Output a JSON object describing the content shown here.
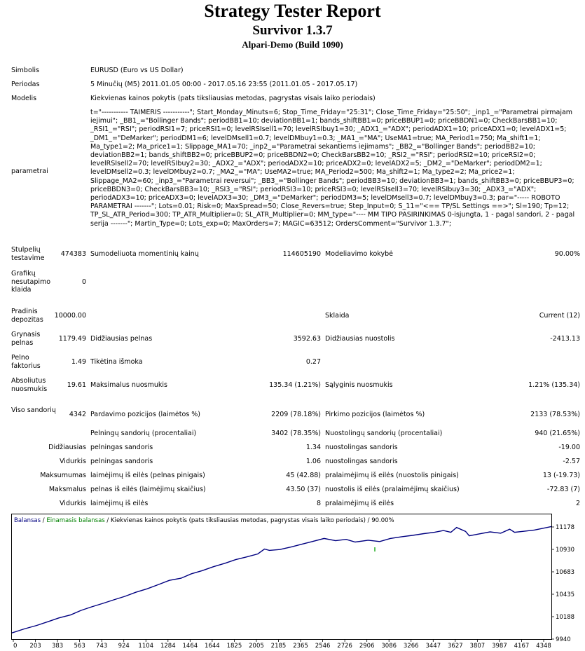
{
  "header": {
    "title": "Strategy Tester Report",
    "subtitle": "Survivor 1.3.7",
    "server": "Alpari-Demo (Build 1090)"
  },
  "info": {
    "symbol_label": "Simbolis",
    "symbol_value": "EURUSD (Euro vs US Dollar)",
    "period_label": "Periodas",
    "period_value": "5 Minučių (M5) 2011.01.05 00:00 - 2017.05.16 23:55 (2011.01.05 - 2017.05.17)",
    "model_label": "Modelis",
    "model_value": "Kiekvienas kainos pokytis (pats tiksliausias metodas, pagrystas visais laiko periodais)",
    "params_label": "parametrai",
    "params_value": "t=\"----------- TAIMERIS -----------\"; Start_Monday_Minuts=6; Stop_Time_Friday=\"25:31\"; Close_Time_Friday=\"25:50\"; _inp1_=\"Parametrai pirmajam iejimui\"; _BB1_=\"Bollinger Bands\"; periodBB1=10; deviationBB1=1; bands_shiftBB1=0; priceBBUP1=0; priceBBDN1=0; CheckBarsBB1=10; _RSI1_=\"RSI\"; periodRSI1=7; priceRSI1=0; levelRSIsell1=70; levelRSIbuy1=30; _ADX1_=\"ADX\"; periodADX1=10; priceADX1=0; levelADX1=5; _DM1_=\"DeMarker\"; periodDM1=6; levelDMsell1=0.7; levelDMbuy1=0.3; _MA1_=\"MA\"; UseMA1=true; MA_Period1=750; Ma_shift1=1; Ma_type1=2; Ma_price1=1; Slippage_MA1=70; _inp2_=\"Parametrai sekantiems iejimams\"; _BB2_=\"Bollinger Bands\"; periodBB2=10; deviationBB2=1; bands_shiftBB2=0; priceBBUP2=0; priceBBDN2=0; CheckBarsBB2=10; _RSI2_=\"RSI\"; periodRSI2=10; priceRSI2=0; levelRSIsell2=70; levelRSIbuy2=30; _ADX2_=\"ADX\"; periodADX2=10; priceADX2=0; levelADX2=5; _DM2_=\"DeMarker\"; periodDM2=1; levelDMsell2=0.3; levelDMbuy2=0.7; _MA2_=\"MA\"; UseMA2=true; MA_Period2=500; Ma_shift2=1; Ma_type2=2; Ma_price2=1; Slippage_MA2=60; _inp3_=\"Parametrai reversui\"; _BB3_=\"Bollinger Bands\"; periodBB3=10; deviationBB3=1; bands_shiftBB3=0; priceBBUP3=0; priceBBDN3=0; CheckBarsBB3=10; _RSI3_=\"RSI\"; periodRSI3=10; priceRSI3=0; levelRSIsell3=70; levelRSIbuy3=30; _ADX3_=\"ADX\"; periodADX3=10; priceADX3=0; levelADX3=30; _DM3_=\"DeMarker\"; periodDM3=5; levelDMsell3=0.7; levelDMbuy3=0.3; par=\"----- ROBOTO PARAMETRAI -------\"; Lots=0.01; Risk=0; MaxSpread=50; Close_Revers=true; Step_Input=0; S_11=\"<== TP/SL Settings ==>\"; Sl=190; Tp=12; TP_SL_ATR_Period=300; TP_ATR_Multiplier=0; SL_ATR_Multiplier=0; MM_type=\"---- MM TIPO PASIRINKIMAS 0-isjungta, 1 - pagal sandori, 2 - pagal serija -------\"; Martin_Type=0; Lots_exp=0; MaxOrders=7; MAGIC=63512; OrdersComment=\"Survivor 1.3.7\";"
  },
  "stats": {
    "bars_label": "Stulpelių testavime",
    "bars_value": "474383",
    "ticks_label": "Sumodeliuota momentinių kainų",
    "ticks_value": "114605190",
    "quality_label": "Modeliavimo kokybė",
    "quality_value": "90.00%",
    "mismatch_label": "Grafikų nesutapimo klaida",
    "mismatch_value": "0",
    "deposit_label": "Pradinis depozitas",
    "deposit_value": "10000.00",
    "spread_label": "Sklaida",
    "spread_value": "Current (12)",
    "netprofit_label": "Grynasis pelnas",
    "netprofit_value": "1179.49",
    "grossprofit_label": "Didžiausias pelnas",
    "grossprofit_value": "3592.63",
    "grossloss_label": "Didžiausias nuostolis",
    "grossloss_value": "-2413.13",
    "pf_label": "Pelno faktorius",
    "pf_value": "1.49",
    "payoff_label": "Tikėtina išmoka",
    "payoff_value": "0.27",
    "absdd_label": "Absoliutus nuosmukis",
    "absdd_value": "19.61",
    "maxdd_label": "Maksimalus nuosmukis",
    "maxdd_value": "135.34 (1.21%)",
    "reldd_label": "Sąlyginis nuosmukis",
    "reldd_value": "1.21% (135.34)",
    "total_label": "Viso sandorių",
    "total_value": "4342",
    "short_label": "Pardavimo pozicijos (laimėtos %)",
    "short_value": "2209 (78.18%)",
    "long_label": "Pirkimo pozicijos (laimėtos %)",
    "long_value": "2133 (78.53%)",
    "wins_label": "Pelningų sandorių (procentaliai)",
    "wins_value": "3402 (78.35%)",
    "losses_label": "Nuostolingų sandorių (procentaliai)",
    "losses_value": "940 (21.65%)",
    "r1_prefix": "Didžiausias",
    "r1_a_label": "pelningas sandoris",
    "r1_a_value": "1.34",
    "r1_b_label": "nuostolingas sandoris",
    "r1_b_value": "-19.00",
    "r2_prefix": "Vidurkis",
    "r2_a_label": "pelningas sandoris",
    "r2_a_value": "1.06",
    "r2_b_label": "nuostolingas sandoris",
    "r2_b_value": "-2.57",
    "r3_prefix": "Maksumumas",
    "r3_a_label": "laimėjimų iš eilės (pelnas pinigais)",
    "r3_a_value": "45 (42.88)",
    "r3_b_label": "pralaimėjimų iš eilės (nuostolis pinigais)",
    "r3_b_value": "13 (-19.73)",
    "r4_prefix": "Maksmalus",
    "r4_a_label": "pelnas iš eilės (laimėjimų skaičius)",
    "r4_a_value": "43.50 (37)",
    "r4_b_label": "nuostolis iš eilės (pralaimėjimų skaičius)",
    "r4_b_value": "-72.83 (7)",
    "r5_prefix": "Vidurkis",
    "r5_a_label": "laimėjimų iš eilės",
    "r5_a_value": "8",
    "r5_b_label": "pralaimėjimų iš eilės",
    "r5_b_value": "2"
  },
  "chart_data": {
    "type": "line",
    "legend": {
      "balance": "Balansas",
      "sep1": " / ",
      "equity": "Einamasis balansas",
      "sep2": " / ",
      "rest": "Kiekvienas kainos pokytis (pats tiksliausias metodas, pagrystas visais laiko periodais) / 90.00%"
    },
    "x_ticks": [
      "0",
      "203",
      "383",
      "563",
      "743",
      "924",
      "1104",
      "1284",
      "1464",
      "1644",
      "1825",
      "2005",
      "2185",
      "2365",
      "2546",
      "2726",
      "2906",
      "3086",
      "3266",
      "3447",
      "3627",
      "3807",
      "3987",
      "4167",
      "4348"
    ],
    "y_ticks": [
      "11178",
      "10930",
      "10683",
      "10435",
      "10188",
      "9940"
    ],
    "xlim": [
      0,
      4400
    ],
    "ylim": [
      9940,
      11250
    ],
    "series": [
      {
        "name": "Balansas",
        "color": "#000080",
        "x": [
          0,
          100,
          203,
          300,
          383,
          480,
          563,
          650,
          743,
          830,
          924,
          1010,
          1104,
          1200,
          1284,
          1380,
          1464,
          1550,
          1644,
          1740,
          1825,
          1910,
          2005,
          2060,
          2100,
          2185,
          2280,
          2365,
          2450,
          2546,
          2640,
          2726,
          2800,
          2906,
          3000,
          3086,
          3180,
          3266,
          3360,
          3447,
          3520,
          3580,
          3627,
          3700,
          3730,
          3807,
          3900,
          3987,
          4060,
          4100,
          4167,
          4260,
          4348,
          4400
        ],
        "y": [
          10010,
          10055,
          10095,
          10140,
          10180,
          10215,
          10265,
          10305,
          10345,
          10385,
          10425,
          10470,
          10510,
          10560,
          10605,
          10630,
          10680,
          10715,
          10760,
          10800,
          10840,
          10870,
          10905,
          10960,
          10945,
          10955,
          10985,
          11015,
          11045,
          11080,
          11055,
          11070,
          11040,
          11060,
          11045,
          11080,
          11100,
          11115,
          11135,
          11150,
          11170,
          11150,
          11205,
          11160,
          11110,
          11130,
          11155,
          11140,
          11185,
          11150,
          11160,
          11175,
          11200,
          11215
        ]
      }
    ]
  }
}
